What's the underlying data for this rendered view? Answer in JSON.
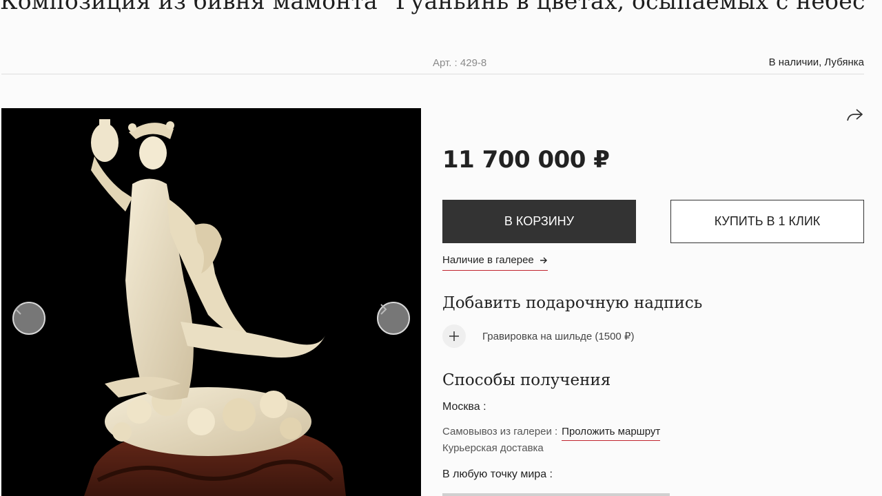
{
  "product": {
    "title": "Композиция из бивня мамонта \"Гуаньинь в цветах, осыпаемых с небес\"",
    "article": "Арт. : 429-8",
    "availability": "В наличии, Лубянка",
    "price": "11 700 000 ₽"
  },
  "gallery": {
    "prev_icon": "chevron-left-icon",
    "next_icon": "chevron-right-icon"
  },
  "actions": {
    "add_to_cart": "В КОРЗИНУ",
    "buy_one_click": "КУПИТЬ В 1 КЛИК",
    "gallery_availability": "Наличие в галерее",
    "share_icon": "share-icon"
  },
  "gift": {
    "heading": "Добавить подарочную надпись",
    "engraving": "Гравировка на шильде (1500 ₽)"
  },
  "delivery": {
    "heading": "Способы получения",
    "moscow": "Москва :",
    "pickup": "Самовывоз из галереи :",
    "route": "Проложить маршрут",
    "courier": "Курьерская доставка",
    "worldwide": "В любую точку мира :"
  },
  "colors": {
    "accent": "#c0232e",
    "button_dark": "#333333"
  }
}
